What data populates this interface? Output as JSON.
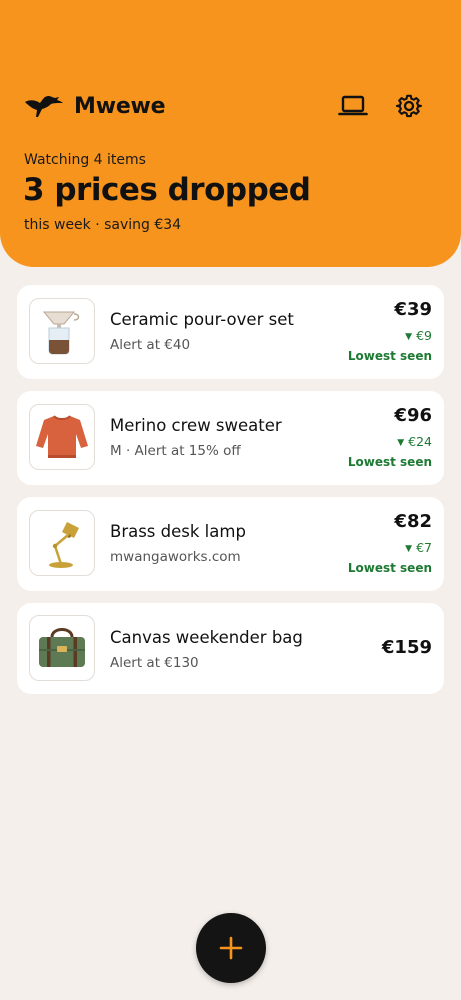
{
  "app": {
    "name": "Mwewe",
    "logo_icon": "bird-logo-icon"
  },
  "header": {
    "watching": "Watching 4 items",
    "headline": "3 prices dropped",
    "subline": "this week · saving €34",
    "actions": [
      {
        "icon": "laptop-icon"
      },
      {
        "icon": "gear-icon"
      }
    ]
  },
  "items": [
    {
      "title": "Ceramic pour-over set",
      "subtitle": "Alert at €40",
      "price": "€39",
      "drop": "€9",
      "badge": "Lowest seen",
      "icon": "pour-over-icon"
    },
    {
      "title": "Merino crew sweater",
      "subtitle": "M · Alert at 15% off",
      "price": "€96",
      "drop": "€24",
      "badge": "Lowest seen",
      "icon": "sweater-icon"
    },
    {
      "title": "Brass desk lamp",
      "subtitle": "mwangaworks.com",
      "price": "€82",
      "drop": "€7",
      "badge": "Lowest seen",
      "icon": "desk-lamp-icon"
    },
    {
      "title": "Canvas weekender bag",
      "subtitle": "Alert at €130",
      "price": "€159",
      "icon": "weekender-bag-icon"
    }
  ],
  "fab": {
    "symbol": "+",
    "icon": "plus-icon"
  },
  "colors": {
    "accent": "#f7941d",
    "background": "#f5efeb",
    "drop_green": "#1e7a33",
    "fab": "#141414"
  }
}
